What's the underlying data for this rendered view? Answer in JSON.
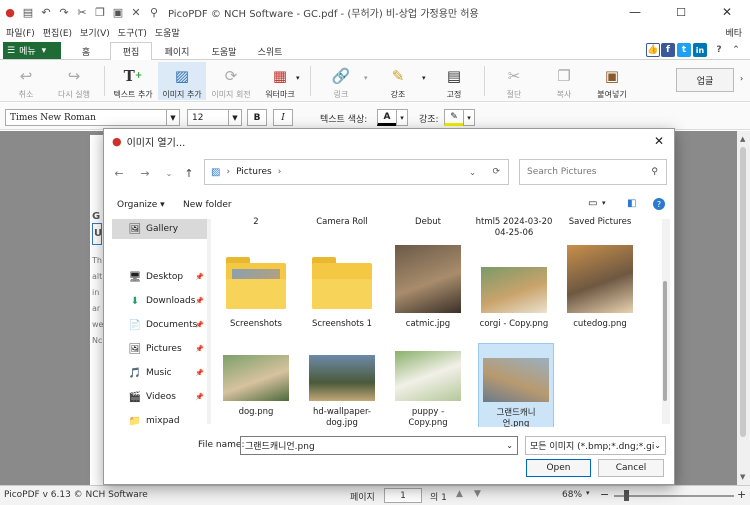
{
  "window": {
    "title": "PicoPDF © NCH Software - GC.pdf - (무허가) 비-상업 가정용만 허용",
    "min": "—",
    "max": "☐",
    "close": "✕"
  },
  "menubar": {
    "items": [
      "파일(F)",
      "편집(E)",
      "보기(V)",
      "도구(T)",
      "도움말"
    ],
    "beta": "베타"
  },
  "ribbon": {
    "menu_label": "메뉴",
    "tabs": [
      "홈",
      "편집",
      "페이지",
      "도움말",
      "스위트"
    ],
    "active": "편집"
  },
  "social": {
    "like": "👍",
    "facebook": "f",
    "twitter": "t",
    "linkedin": "in"
  },
  "toolbar": {
    "undo": "취소",
    "redo": "다시 실행",
    "add_text": "텍스트 추가",
    "add_image": "이미지 추가",
    "rotate_image": "이미지 회전",
    "watermark": "워터마크",
    "link": "링크",
    "highlight": "강조",
    "pin": "고정",
    "cut": "절단",
    "copy": "복사",
    "paste": "붙여넣기",
    "upgrade": "업글"
  },
  "formatbar": {
    "font": "Times New Roman",
    "size": "12",
    "bold": "B",
    "italic": "I",
    "text_color_label": "텍스트 색상:",
    "highlight_label": "강조:",
    "text_color_glyph": "A"
  },
  "document": {
    "heading_chars": [
      "G",
      "U"
    ],
    "body_chars": [
      "Th",
      "alt",
      "in",
      "ar",
      "we",
      "Nc"
    ]
  },
  "statusbar": {
    "version": "PicoPDF v 6.13 © NCH Software",
    "page_label": "페이지",
    "page_value": "1",
    "of_label": "의 1",
    "zoom": "68%"
  },
  "dialog": {
    "title": "이미지 열기...",
    "close": "✕",
    "address": {
      "folder": "Pictures",
      "separator": "›"
    },
    "search_placeholder": "Search Pictures",
    "organize": "Organize ▾",
    "new_folder": "New folder",
    "nav": [
      {
        "label": "Gallery",
        "icon": "🖼",
        "selected": true
      },
      {
        "label": "Desktop",
        "icon": "🖥",
        "pinned": true
      },
      {
        "label": "Downloads",
        "icon": "⬇",
        "pinned": true
      },
      {
        "label": "Documents",
        "icon": "📄",
        "pinned": true
      },
      {
        "label": "Pictures",
        "icon": "🖼",
        "pinned": true
      },
      {
        "label": "Music",
        "icon": "🎵",
        "pinned": true
      },
      {
        "label": "Videos",
        "icon": "🎬",
        "pinned": true
      },
      {
        "label": "mixpad",
        "icon": "📁"
      }
    ],
    "files_top": [
      "2",
      "Camera Roll",
      "Debut",
      "html5 2024-03-20 04-25-06",
      "Saved Pictures"
    ],
    "files_row1": [
      {
        "name": "Screenshots",
        "kind": "folder"
      },
      {
        "name": "Screenshots 1",
        "kind": "folder"
      },
      {
        "name": "catmic.jpg",
        "kind": "image",
        "palette": [
          "#6b5a48",
          "#a88c6c",
          "#3a3028"
        ]
      },
      {
        "name": "corgi - Copy.png",
        "kind": "image",
        "palette": [
          "#7b9a6a",
          "#c9a36b",
          "#eae2cf"
        ]
      },
      {
        "name": "cutedog.png",
        "kind": "image",
        "palette": [
          "#c98f4a",
          "#6e5842",
          "#e8d3b2"
        ]
      }
    ],
    "files_row2": [
      {
        "name": "dog.png",
        "kind": "image",
        "palette": [
          "#7da06a",
          "#d7c2a0",
          "#4c6a3a"
        ]
      },
      {
        "name": "hd-wallpaper-dog.jpg",
        "kind": "image",
        "palette": [
          "#6d8aa8",
          "#4a5a3a",
          "#c2a878"
        ]
      },
      {
        "name": "puppy - Copy.png",
        "kind": "image",
        "palette": [
          "#8ab06a",
          "#f2f0e8",
          "#b4c89a"
        ]
      },
      {
        "name": "그랜드캐니언.png",
        "kind": "image",
        "palette": [
          "#9ab0c0",
          "#b89a70",
          "#6a7a8a"
        ],
        "selected": true
      }
    ],
    "filename_label": "File name:",
    "filename_value": "그랜드캐니언.png",
    "filetype": "모든 이미지 (*.bmp;*.dng;*.gif;",
    "open": "Open",
    "cancel": "Cancel"
  }
}
